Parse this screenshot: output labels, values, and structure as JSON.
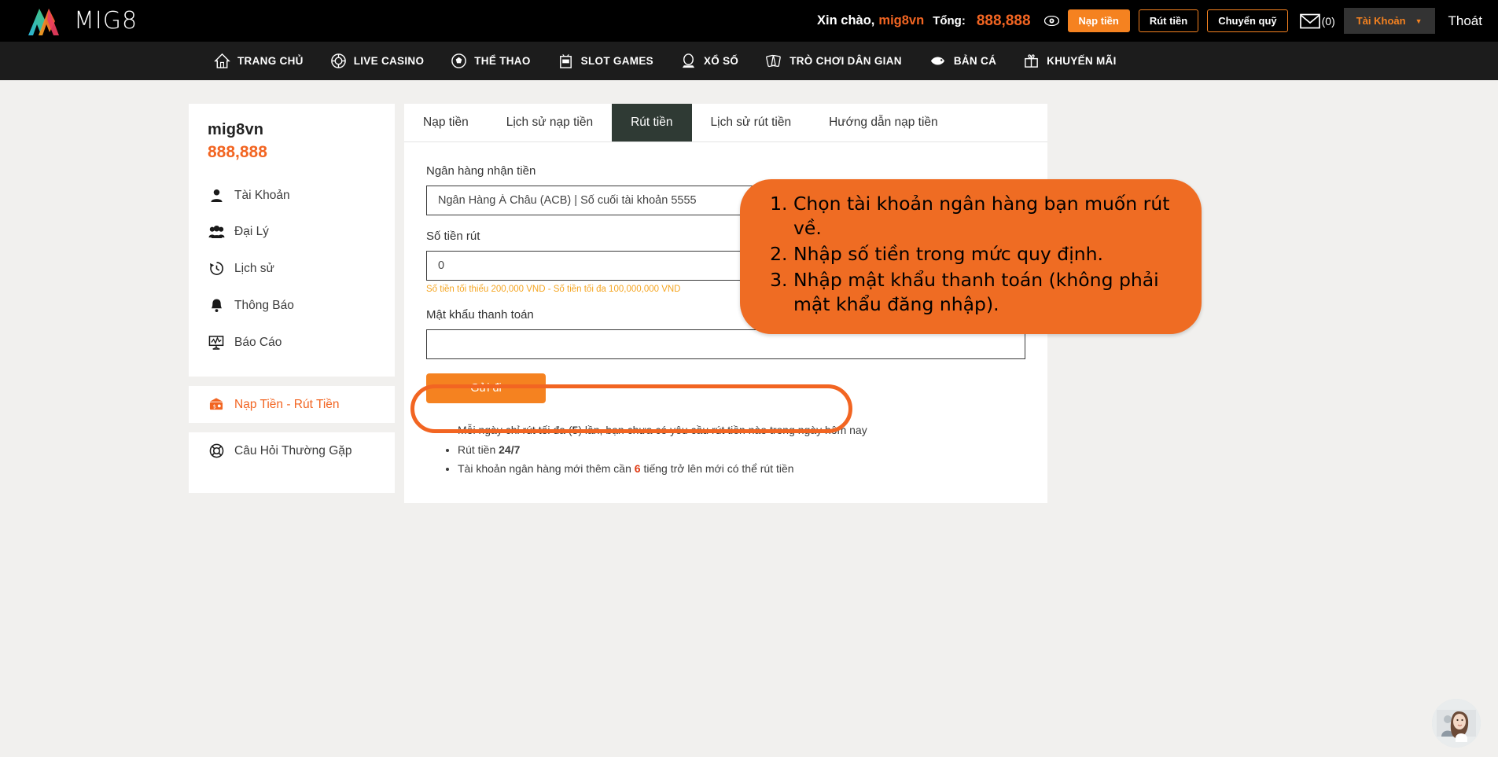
{
  "header": {
    "logo_text": "MIG8",
    "greeting": "Xin chào,",
    "username": "mig8vn",
    "total_label": "Tổng:",
    "total_value": "888,888",
    "deposit_button": "Nạp tiền",
    "withdraw_button": "Rút tiền",
    "transfer_button": "Chuyển quỹ",
    "mail_count": "(0)",
    "account_menu": "Tài Khoản",
    "logout": "Thoát",
    "accent_color": "#f26522"
  },
  "nav": {
    "items": [
      {
        "label": "TRANG CHỦ",
        "icon": "home-icon"
      },
      {
        "label": "LIVE CASINO",
        "icon": "chip-icon"
      },
      {
        "label": "THỂ THAO",
        "icon": "soccer-ball-icon"
      },
      {
        "label": "SLOT GAMES",
        "icon": "slot-machine-icon"
      },
      {
        "label": "XỔ SỐ",
        "icon": "lottery-icon"
      },
      {
        "label": "TRÒ CHƠI DÂN GIAN",
        "icon": "cards-icon"
      },
      {
        "label": "BẢN CÁ",
        "icon": "fish-icon"
      },
      {
        "label": "KHUYẾN MÃI",
        "icon": "gift-icon"
      }
    ]
  },
  "sidebar": {
    "username": "mig8vn",
    "balance": "888,888",
    "group1": [
      {
        "label": "Tài Khoản",
        "icon": "user-icon"
      },
      {
        "label": "Đại Lý",
        "icon": "users-icon"
      },
      {
        "label": "Lịch sử",
        "icon": "history-icon"
      },
      {
        "label": "Thông Báo",
        "icon": "bell-icon"
      },
      {
        "label": "Báo Cáo",
        "icon": "report-icon"
      }
    ],
    "group2": [
      {
        "label": "Nạp Tiền - Rút Tiền",
        "icon": "wallet-icon",
        "active": true
      }
    ],
    "group3": [
      {
        "label": "Câu Hỏi Thường Gặp",
        "icon": "lifebuoy-icon"
      }
    ]
  },
  "main": {
    "tabs": [
      {
        "label": "Nạp tiền",
        "active": false
      },
      {
        "label": "Lịch sử nạp tiền",
        "active": false
      },
      {
        "label": "Rút tiền",
        "active": true
      },
      {
        "label": "Lịch sử rút tiền",
        "active": false
      },
      {
        "label": "Hướng dẫn nạp tiền",
        "active": false
      }
    ],
    "form": {
      "bank_label": "Ngân hàng nhận tiền",
      "bank_value": "Ngân Hàng Á Châu (ACB) | Số cuối tài khoản 5555",
      "amount_label": "Số tiền rút",
      "amount_value": "0",
      "amount_hint": "Số tiền tối thiểu 200,000 VND - Số tiền tối đa 100,000,000 VND",
      "password_label": "Mật khẩu thanh toán",
      "password_value": "",
      "submit_label": "Gửi đi"
    },
    "notes": [
      {
        "pre": "Mỗi ngày chỉ rút tối đa (",
        "bold": "5",
        "post": ") lần, bạn chưa có yêu cầu rút tiền nào trong ngày hôm nay"
      },
      {
        "pre": "Rút tiền ",
        "bold": "24/7",
        "post": ""
      },
      {
        "pre": "Tài khoản ngân hàng mới thêm cần ",
        "bold": "6",
        "post": " tiếng trở lên mới có thể rút tiền"
      }
    ]
  },
  "callout": {
    "background": "#ef6c23",
    "steps": [
      "Chọn tài khoản ngân hàng bạn muốn rút về.",
      "Nhập số tiền trong mức quy định.",
      "Nhập mật khẩu thanh toán (không phải mật khẩu đăng nhập)."
    ]
  },
  "chat": {
    "icon": "support-agent-avatar"
  }
}
